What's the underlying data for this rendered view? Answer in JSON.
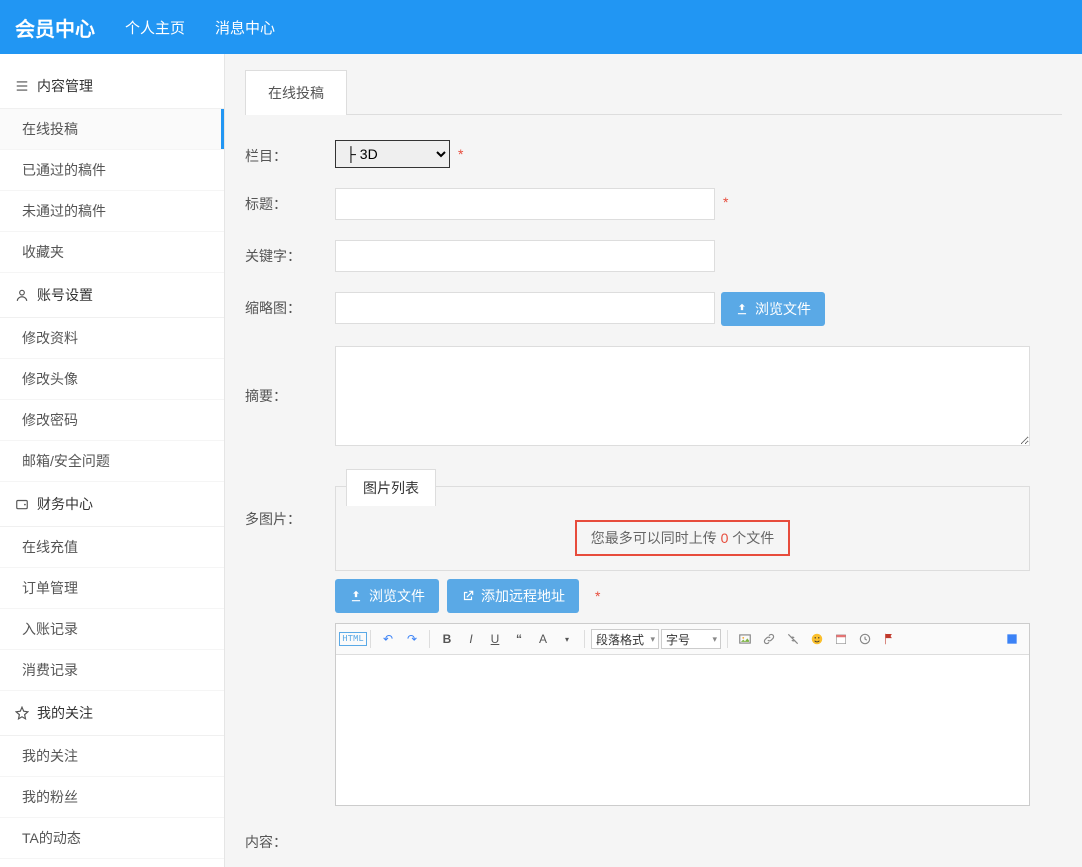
{
  "header": {
    "brand": "会员中心",
    "nav": [
      "个人主页",
      "消息中心"
    ]
  },
  "sidebar": {
    "groups": [
      {
        "title": "内容管理",
        "items": [
          "在线投稿",
          "已通过的稿件",
          "未通过的稿件",
          "收藏夹"
        ],
        "active": 0
      },
      {
        "title": "账号设置",
        "items": [
          "修改资料",
          "修改头像",
          "修改密码",
          "邮箱/安全问题"
        ]
      },
      {
        "title": "财务中心",
        "items": [
          "在线充值",
          "订单管理",
          "入账记录",
          "消费记录"
        ]
      },
      {
        "title": "我的关注",
        "items": [
          "我的关注",
          "我的粉丝",
          "TA的动态"
        ]
      }
    ]
  },
  "tab_label": "在线投稿",
  "form": {
    "column_label": "栏目：",
    "column_value": "├ 3D",
    "title_label": "标题：",
    "keyword_label": "关键字：",
    "thumb_label": "缩略图：",
    "browse_btn": "浏览文件",
    "summary_label": "摘要：",
    "multi_label": "多图片：",
    "img_list_tab": "图片列表",
    "upload_hint_pre": "您最多可以同时上传 ",
    "upload_hint_num": "0",
    "upload_hint_post": " 个文件",
    "browse_btn2": "浏览文件",
    "remote_btn": "添加远程地址",
    "content_label": "内容：",
    "editor": {
      "para_fmt": "段落格式",
      "font_size": "字号"
    }
  }
}
